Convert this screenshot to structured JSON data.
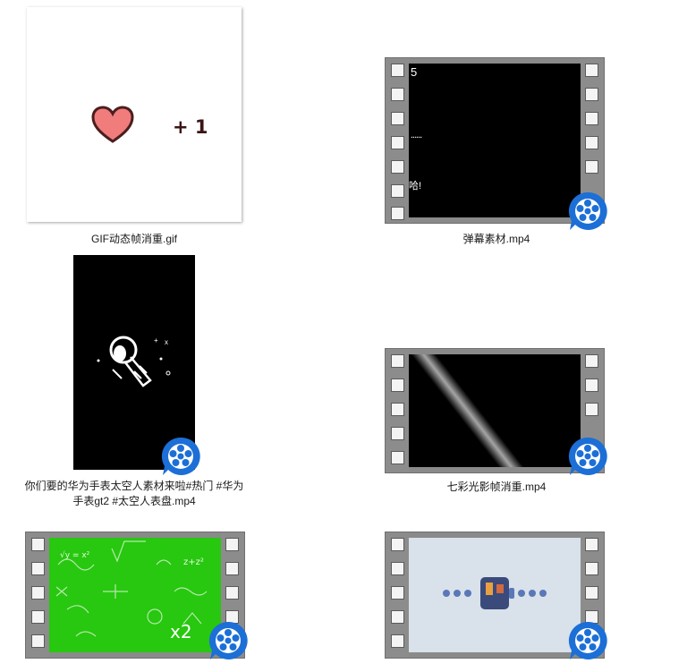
{
  "files": [
    {
      "name": "GIF动态帧消重.gif",
      "type": "gif",
      "overlay_text": "+ 1"
    },
    {
      "name": "弹幕素材.mp4",
      "type": "video",
      "frame_texts": [
        "5",
        "......",
        "哈!"
      ]
    },
    {
      "name_line1": "你们要的华为手表太空人素材来啦#热门 #华为",
      "name_line2": "手表gt2 #太空人表盘.mp4",
      "type": "video"
    },
    {
      "name": "七彩光影帧消重.mp4",
      "type": "video"
    },
    {
      "name": "",
      "type": "video",
      "frame_texts": [
        "x2"
      ]
    },
    {
      "name": "",
      "type": "video"
    }
  ],
  "colors": {
    "badge_blue": "#1c6fd6",
    "green_screen": "#27c80f",
    "heart": "#f07c7c"
  }
}
